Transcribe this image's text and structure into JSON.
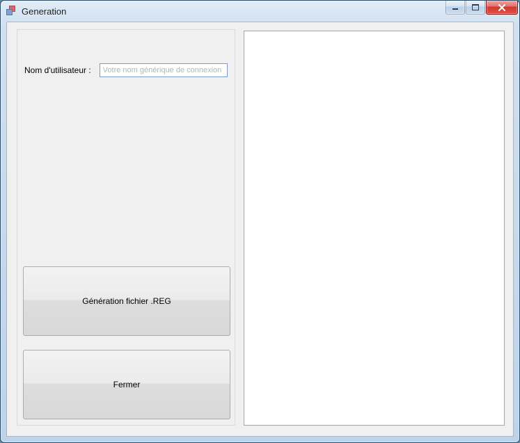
{
  "window": {
    "title": "Generation"
  },
  "form": {
    "username_label": "Nom d'utilisateur :",
    "username_value": "Votre nom générique de connexion"
  },
  "buttons": {
    "generate": "Génération fichier .REG",
    "close": "Fermer"
  },
  "output": {
    "text": ""
  }
}
